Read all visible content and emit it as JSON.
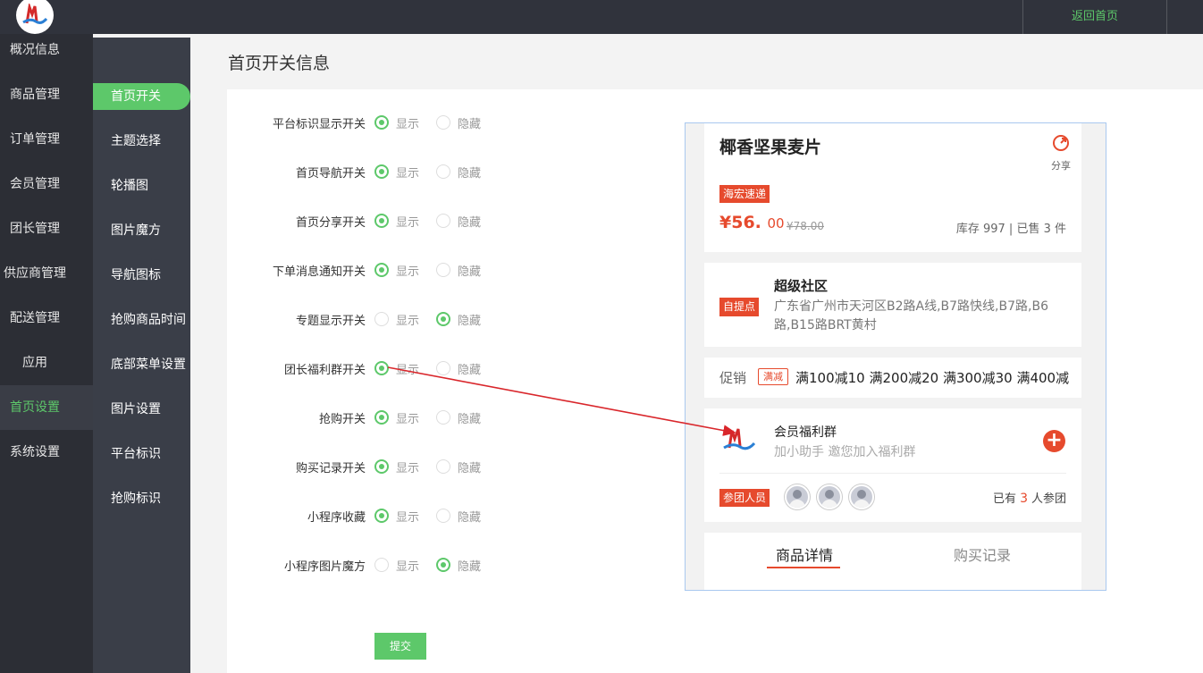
{
  "topbar": {
    "home_label": "返回首页"
  },
  "sidebar": {
    "items": [
      {
        "label": "概况信息"
      },
      {
        "label": "商品管理"
      },
      {
        "label": "订单管理"
      },
      {
        "label": "会员管理"
      },
      {
        "label": "团长管理"
      },
      {
        "label": "供应商管理"
      },
      {
        "label": "配送管理"
      },
      {
        "label": "应用"
      },
      {
        "label": "首页设置"
      },
      {
        "label": "系统设置"
      }
    ],
    "active": "首页设置"
  },
  "subnav": {
    "items": [
      {
        "label": "首页开关"
      },
      {
        "label": "主题选择"
      },
      {
        "label": "轮播图"
      },
      {
        "label": "图片魔方"
      },
      {
        "label": "导航图标"
      },
      {
        "label": "抢购商品时间"
      },
      {
        "label": "底部菜单设置"
      },
      {
        "label": "图片设置"
      },
      {
        "label": "平台标识"
      },
      {
        "label": "抢购标识"
      }
    ],
    "active": "首页开关"
  },
  "page": {
    "title": "首页开关信息"
  },
  "form": {
    "option_show": "显示",
    "option_hide": "隐藏",
    "rows": [
      {
        "label": "平台标识显示开关",
        "value": "显示"
      },
      {
        "label": "首页导航开关",
        "value": "显示"
      },
      {
        "label": "首页分享开关",
        "value": "显示"
      },
      {
        "label": "下单消息通知开关",
        "value": "显示"
      },
      {
        "label": "专题显示开关",
        "value": "隐藏"
      },
      {
        "label": "团长福利群开关",
        "value": "显示"
      },
      {
        "label": "抢购开关",
        "value": "显示"
      },
      {
        "label": "购买记录开关",
        "value": "显示"
      },
      {
        "label": "小程序收藏",
        "value": "显示"
      },
      {
        "label": "小程序图片魔方",
        "value": "隐藏"
      }
    ],
    "submit_label": "提交"
  },
  "preview": {
    "product_title": "椰香坚果麦片",
    "share_label": "分享",
    "shipping_tag": "海宏速递",
    "price_int": "¥56.",
    "price_dec": "00",
    "price_old": "¥78.00",
    "stock": "库存 997 | 已售 3 件",
    "pickup_tag": "自提点",
    "community_name": "超级社区",
    "community_addr": "广东省广州市天河区B2路A线,B7路快线,B7路,B6路,B15路BRT黄村",
    "promo_label": "促销",
    "promo_tag": "满减",
    "promo_items": "满100减10   满200减20   满300减30   满400减",
    "group_title": "会员福利群",
    "group_sub": "加小助手 邀您加入福利群",
    "members_tag": "参团人员",
    "joined_prefix": "已有",
    "joined_count": "3",
    "joined_suffix": "人参团",
    "tab_detail": "商品详情",
    "tab_records": "购买记录"
  },
  "colors": {
    "accent": "#5dc86a",
    "brand_red": "#e64a2d",
    "sidebar_bg": "#2c2e35",
    "annotation_arrow": "#d9262b"
  }
}
